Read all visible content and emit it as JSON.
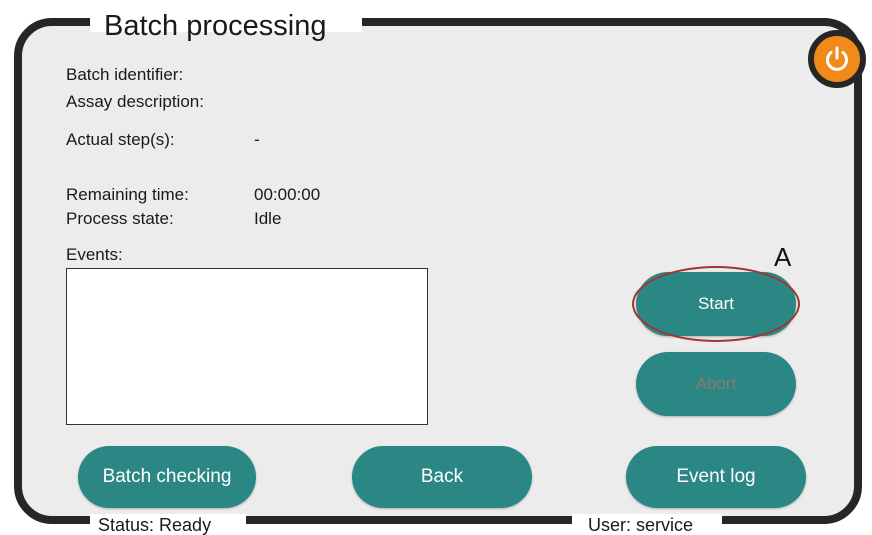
{
  "window": {
    "title": "Batch processing"
  },
  "fields": {
    "batch_identifier_label": "Batch identifier:",
    "assay_description_label": "Assay description:",
    "actual_steps_label": "Actual step(s):",
    "actual_steps_value": "-",
    "remaining_time_label": "Remaining time:",
    "remaining_time_value": "00:00:00",
    "process_state_label": "Process state:",
    "process_state_value": "Idle",
    "events_label": "Events:"
  },
  "buttons": {
    "start": "Start",
    "abort": "Abort",
    "batch_checking": "Batch checking",
    "back": "Back",
    "event_log": "Event log"
  },
  "annotation": {
    "letter": "A"
  },
  "statusbar": {
    "status": "Status: Ready",
    "user": "User: service"
  },
  "colors": {
    "button_teal": "#2b8784",
    "power_orange": "#f08a1a",
    "frame_dark": "#262626",
    "panel_bg": "#ececec",
    "annotation_red": "#a23431"
  },
  "icons": {
    "power": "power-icon"
  }
}
